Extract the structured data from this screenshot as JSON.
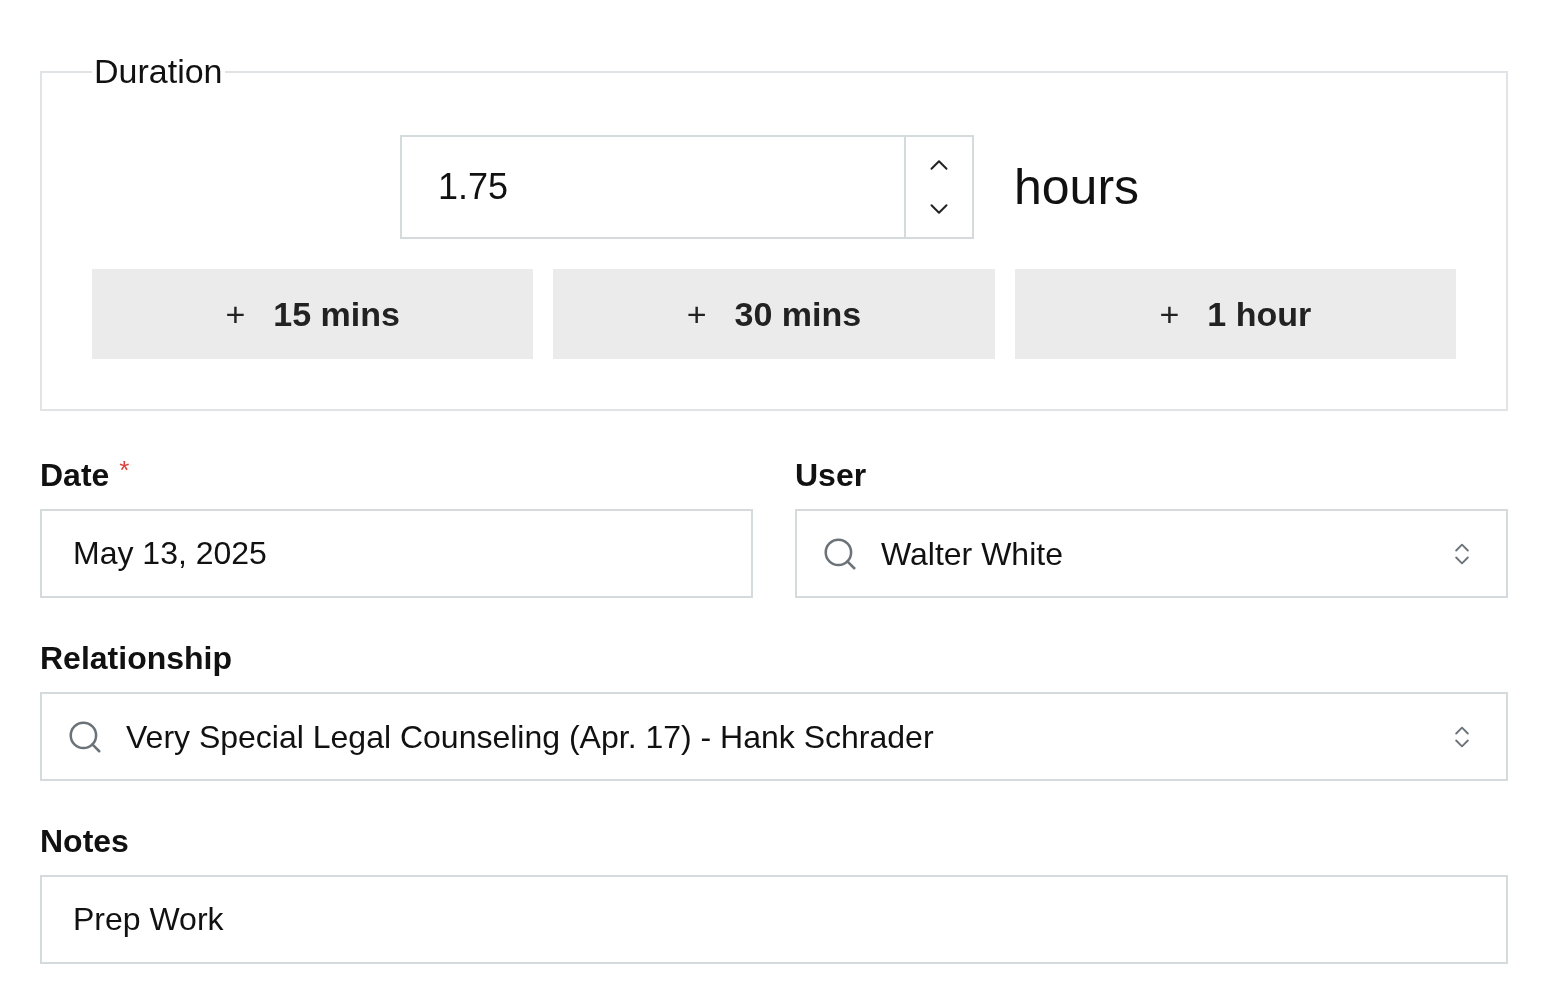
{
  "duration": {
    "legend": "Duration",
    "value": "1.75",
    "unit": "hours",
    "quick_add": [
      {
        "symbol": "+",
        "label": "15 mins"
      },
      {
        "symbol": "+",
        "label": "30 mins"
      },
      {
        "symbol": "+",
        "label": "1 hour"
      }
    ]
  },
  "field_rows": [
    [
      {
        "kind": "text",
        "label": "Date",
        "required_mark": "*",
        "value": "May 13, 2025"
      },
      {
        "kind": "combobox",
        "label": "User",
        "value": "Walter White"
      }
    ],
    [
      {
        "kind": "combobox",
        "label": "Relationship",
        "value": "Very Special Legal Counseling (Apr. 17) - Hank Schrader"
      }
    ],
    [
      {
        "kind": "text",
        "label": "Notes",
        "value": "Prep Work"
      }
    ]
  ]
}
